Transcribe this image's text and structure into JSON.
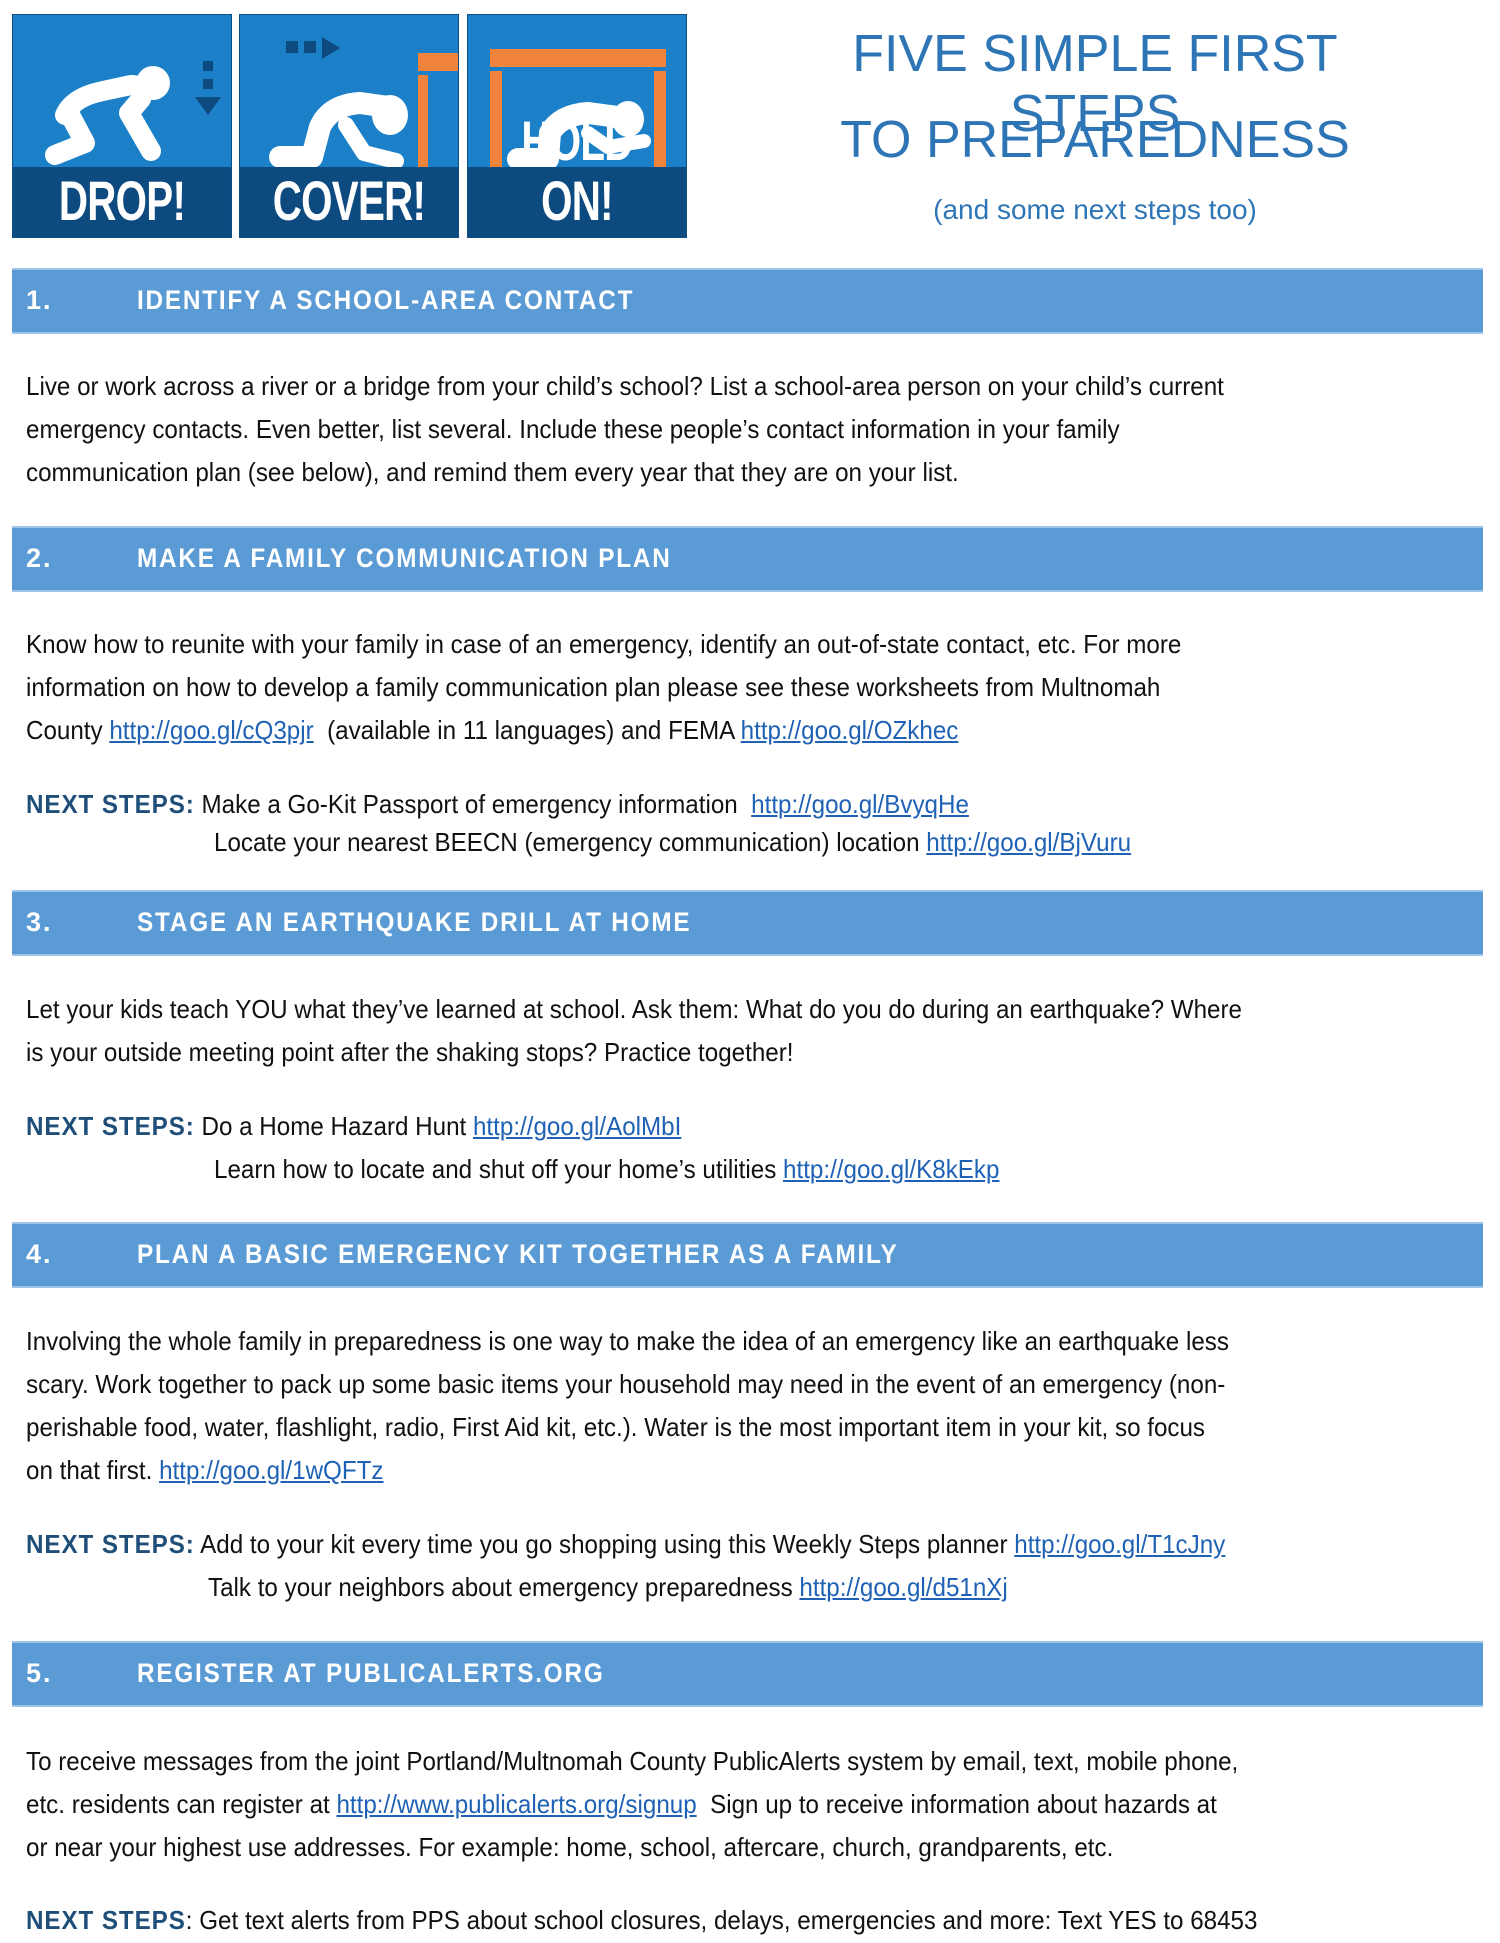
{
  "banner": {
    "tiles": [
      {
        "label": "DROP!",
        "icon": "person-dropping-icon"
      },
      {
        "label": "COVER!",
        "icon": "person-taking-cover-icon"
      },
      {
        "label": "HOLD ON!",
        "icon": "person-holding-on-icon"
      }
    ],
    "colors": {
      "tile_blue": "#1b80c8",
      "tile_dark": "#0d4a80",
      "table_orange": "#f0843c"
    }
  },
  "title": {
    "line1": "FIVE SIMPLE FIRST STEPS",
    "line2": "TO PREPAREDNESS",
    "subtitle": "(and some next steps too)",
    "color": "#2e75b6"
  },
  "theme": {
    "header_bar": "#5b9bd5",
    "next_steps_label": "#1f4e79",
    "link": "#1f62b5"
  },
  "next_steps_label": "NEXT STEPS:",
  "next_steps_label_plain": "NEXT STEPS",
  "colon": ":",
  "sections": [
    {
      "number": "1.",
      "title": "IDENTIFY A SCHOOL-AREA CONTACT",
      "body": [
        "Live or work across a river or a bridge from your child’s school? List a school-area person on your child’s current",
        "emergency contacts. Even better, list several.  Include these people’s contact information in your family",
        "communication plan (see below), and remind them every year that they are on your list."
      ]
    },
    {
      "number": "2.",
      "title": "MAKE A FAMILY COMMUNICATION PLAN",
      "body": [
        "Know how to reunite with your family in case of an emergency, identify an out-of-state contact, etc. For more",
        "information on how to develop a family communication plan please see these worksheets from Multnomah"
      ],
      "body_line3": {
        "pre": "County ",
        "link1": "http://goo.gl/cQ3pjr",
        "mid": "  (available in 11 languages) and FEMA ",
        "link2": "http://goo.gl/OZkhec"
      },
      "next_steps": [
        {
          "text": "Make a Go-Kit Passport of emergency information  ",
          "link": "http://goo.gl/BvyqHe"
        },
        {
          "text": "Locate your nearest BEECN (emergency communication) location ",
          "link": "http://goo.gl/BjVuru"
        }
      ]
    },
    {
      "number": "3.",
      "title": "STAGE AN EARTHQUAKE DRILL AT HOME",
      "body": [
        "Let your kids teach YOU what they’ve learned at school. Ask them: What do you do during an earthquake? Where",
        "is your outside meeting point after the shaking stops? Practice together!"
      ],
      "next_steps": [
        {
          "text": "Do a Home Hazard Hunt ",
          "link": "http://goo.gl/AolMbI"
        },
        {
          "text": "Learn how to locate and shut off your home’s utilities ",
          "link": "http://goo.gl/K8kEkp"
        }
      ]
    },
    {
      "number": "4.",
      "title": "PLAN A BASIC EMERGENCY KIT TOGETHER AS A FAMILY",
      "body": [
        "Involving the whole family in preparedness is one way to make the idea of an emergency like an earthquake less",
        "scary.  Work together to pack up some basic items your household may need in the event of an emergency (non-",
        "perishable food, water, flashlight, radio, First Aid kit, etc.). Water is the most important item in your kit, so focus"
      ],
      "body_line4": {
        "pre": "on that first. ",
        "link": "http://goo.gl/1wQFTz"
      },
      "next_steps": [
        {
          "text": "Add to your kit every time you go shopping using this Weekly Steps planner ",
          "link": "http://goo.gl/T1cJny"
        },
        {
          "text": "Talk to your neighbors about emergency preparedness ",
          "link": "http://goo.gl/d51nXj"
        }
      ]
    },
    {
      "number": "5.",
      "title": "REGISTER AT PUBLICALERTS.ORG",
      "body_line1": "To receive messages from the joint Portland/Multnomah County PublicAlerts system by email, text, mobile phone,",
      "body_line2": {
        "pre": "etc. residents can register at ",
        "link": "http://www.publicalerts.org/signup",
        "post": "  Sign up to receive information about hazards at"
      },
      "body_line3": "or near your highest use addresses. For example: home, school, aftercare, church, grandparents, etc.",
      "next_steps": [
        {
          "text": " Get text alerts from PPS about school closures, delays, emergencies and more: Text YES to 68453"
        }
      ]
    }
  ]
}
